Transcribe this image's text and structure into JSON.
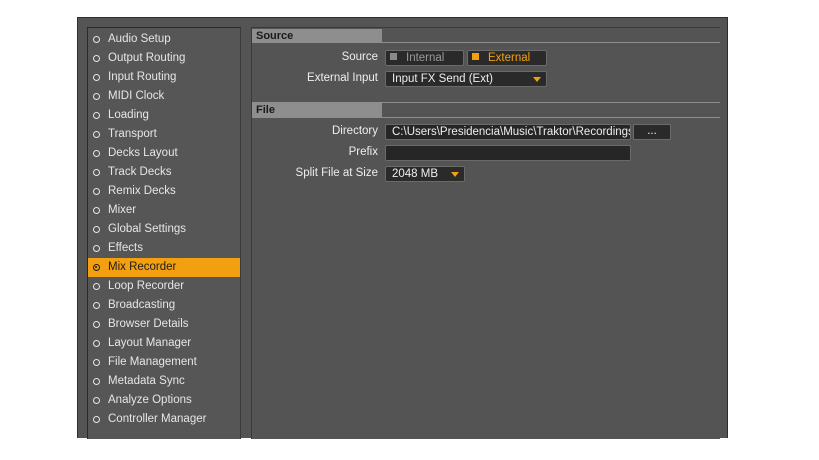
{
  "sidebar": {
    "items": [
      {
        "label": "Audio Setup",
        "active": false
      },
      {
        "label": "Output Routing",
        "active": false
      },
      {
        "label": "Input Routing",
        "active": false
      },
      {
        "label": "MIDI Clock",
        "active": false
      },
      {
        "label": "Loading",
        "active": false
      },
      {
        "label": "Transport",
        "active": false
      },
      {
        "label": "Decks Layout",
        "active": false
      },
      {
        "label": "Track Decks",
        "active": false
      },
      {
        "label": "Remix Decks",
        "active": false
      },
      {
        "label": "Mixer",
        "active": false
      },
      {
        "label": "Global Settings",
        "active": false
      },
      {
        "label": "Effects",
        "active": false
      },
      {
        "label": "Mix Recorder",
        "active": true
      },
      {
        "label": "Loop Recorder",
        "active": false
      },
      {
        "label": "Broadcasting",
        "active": false
      },
      {
        "label": "Browser Details",
        "active": false
      },
      {
        "label": "Layout Manager",
        "active": false
      },
      {
        "label": "File Management",
        "active": false
      },
      {
        "label": "Metadata Sync",
        "active": false
      },
      {
        "label": "Analyze Options",
        "active": false
      },
      {
        "label": "Controller Manager",
        "active": false
      }
    ]
  },
  "source_section": {
    "title": "Source",
    "source_label": "Source",
    "internal_label": "Internal",
    "external_label": "External",
    "selected": "External",
    "external_input_label": "External Input",
    "external_input_value": "Input FX Send (Ext)"
  },
  "file_section": {
    "title": "File",
    "directory_label": "Directory",
    "directory_value": "C:\\Users\\Presidencia\\Music\\Traktor\\Recordings",
    "browse_label": "...",
    "prefix_label": "Prefix",
    "prefix_value": "",
    "split_label": "Split File at Size",
    "split_value": "2048 MB"
  },
  "colors": {
    "accent": "#f3a010",
    "panel": "#545454",
    "header": "#8e8e8e",
    "field": "#262626"
  }
}
